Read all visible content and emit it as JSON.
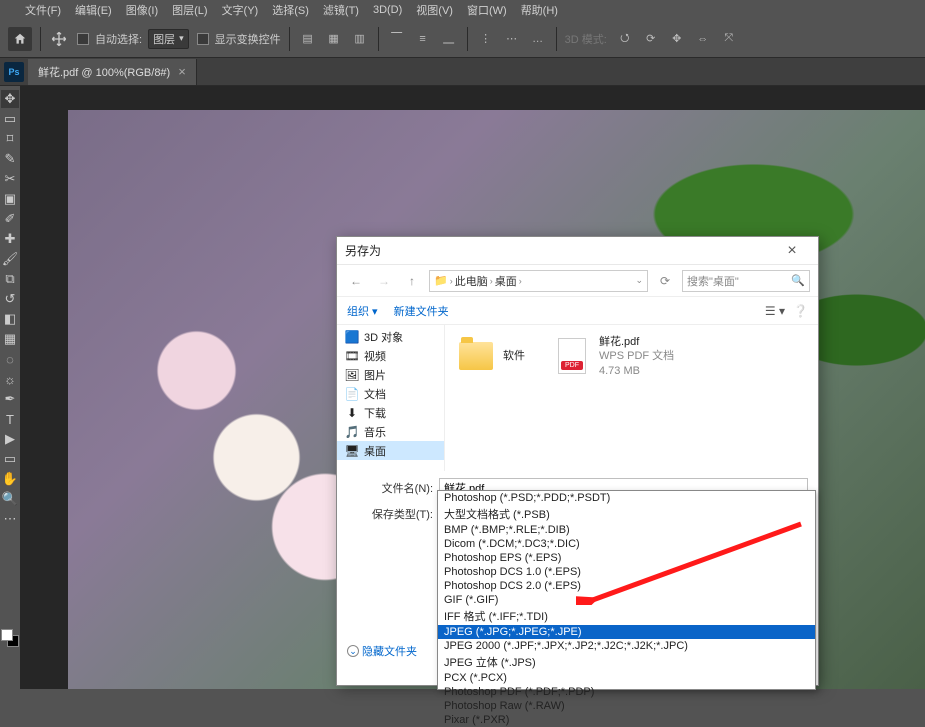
{
  "menu": {
    "items": [
      "文件(F)",
      "编辑(E)",
      "图像(I)",
      "图层(L)",
      "文字(Y)",
      "选择(S)",
      "滤镜(T)",
      "3D(D)",
      "视图(V)",
      "窗口(W)",
      "帮助(H)"
    ]
  },
  "options": {
    "auto_select_label": "自动选择:",
    "layer_dd": "图层",
    "show_transform": "显示变换控件",
    "mode3d_label": "3D 模式:"
  },
  "doc_tab": {
    "title": "鲜花.pdf @ 100%(RGB/8#)"
  },
  "dialog": {
    "title": "另存为",
    "breadcrumb": {
      "icon": "pc",
      "seg1": "此电脑",
      "seg2": "桌面"
    },
    "search_placeholder": "搜索\"桌面\"",
    "toolbar": {
      "organize": "组织",
      "new_folder": "新建文件夹"
    },
    "tree": [
      {
        "icon": "cube",
        "label": "3D 对象"
      },
      {
        "icon": "video",
        "label": "视频"
      },
      {
        "icon": "image",
        "label": "图片"
      },
      {
        "icon": "doc",
        "label": "文档"
      },
      {
        "icon": "download",
        "label": "下载"
      },
      {
        "icon": "music",
        "label": "音乐"
      },
      {
        "icon": "desktop",
        "label": "桌面",
        "selected": true
      }
    ],
    "files": {
      "folder": {
        "name": "软件"
      },
      "pdf": {
        "name": "鲜花.pdf",
        "kind": "WPS PDF 文档",
        "size": "4.73 MB"
      }
    },
    "filename_label": "文件名(N):",
    "filename_value": "鲜花.pdf",
    "savetype_label": "保存类型(T):",
    "savetype_value": "Photoshop PDF (*.PDF;*.PDP)",
    "hide_folders": "隐藏文件夹",
    "type_options": [
      "Photoshop (*.PSD;*.PDD;*.PSDT)",
      "大型文档格式 (*.PSB)",
      "BMP (*.BMP;*.RLE;*.DIB)",
      "Dicom (*.DCM;*.DC3;*.DIC)",
      "Photoshop EPS (*.EPS)",
      "Photoshop DCS 1.0 (*.EPS)",
      "Photoshop DCS 2.0 (*.EPS)",
      "GIF (*.GIF)",
      "IFF 格式 (*.IFF;*.TDI)",
      "JPEG (*.JPG;*.JPEG;*.JPE)",
      "JPEG 2000 (*.JPF;*.JPX;*.JP2;*.J2C;*.J2K;*.JPC)",
      "JPEG 立体 (*.JPS)",
      "PCX (*.PCX)",
      "Photoshop PDF (*.PDF;*.PDP)",
      "Photoshop Raw (*.RAW)",
      "Pixar (*.PXR)"
    ],
    "highlight_index": 9
  }
}
